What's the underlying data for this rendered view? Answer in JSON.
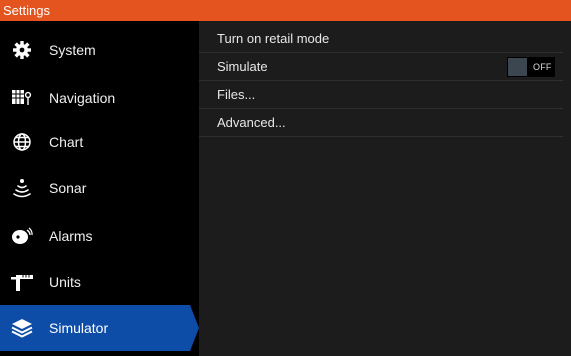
{
  "window": {
    "title": "Settings"
  },
  "sidebar": {
    "items": [
      {
        "label": "System",
        "icon": "gear-icon"
      },
      {
        "label": "Navigation",
        "icon": "navigation-icon"
      },
      {
        "label": "Chart",
        "icon": "globe-icon"
      },
      {
        "label": "Sonar",
        "icon": "sonar-icon"
      },
      {
        "label": "Alarms",
        "icon": "alarm-icon"
      },
      {
        "label": "Units",
        "icon": "units-icon"
      },
      {
        "label": "Simulator",
        "icon": "simulator-layers-icon"
      }
    ],
    "active_index": 6
  },
  "content": {
    "rows": [
      {
        "label": "Turn on retail mode"
      },
      {
        "label": "Simulate",
        "toggle_state": "OFF"
      },
      {
        "label": "Files..."
      },
      {
        "label": "Advanced..."
      }
    ]
  },
  "colors": {
    "titlebar": "#e3541f",
    "active_item": "#0d4da8",
    "content_bg": "#1c1c1c"
  }
}
